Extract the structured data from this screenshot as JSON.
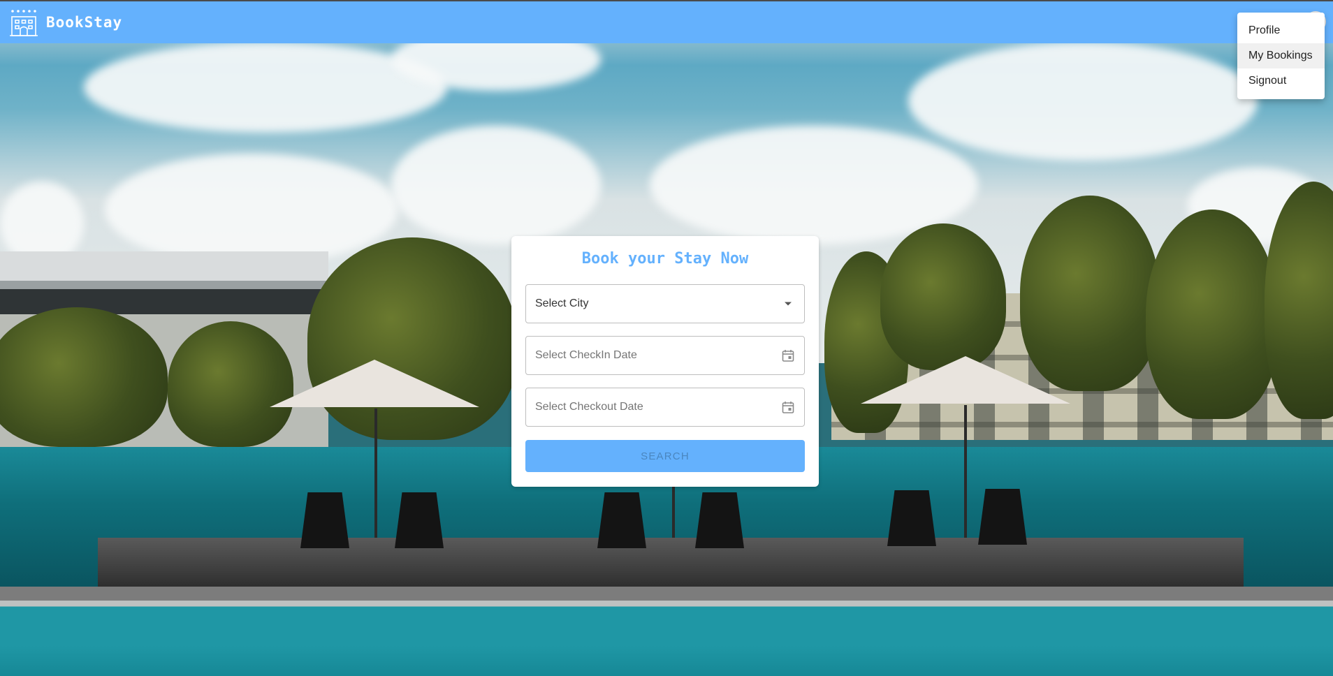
{
  "app": {
    "name": "BookStay"
  },
  "user_menu": {
    "items": [
      {
        "label": "Profile"
      },
      {
        "label": "My Bookings"
      },
      {
        "label": "Signout"
      }
    ],
    "highlighted_item": "My Bookings"
  },
  "booking_form": {
    "title": "Book your Stay Now",
    "city_select": {
      "placeholder": "Select City",
      "icon": "chevron-down-icon"
    },
    "checkin": {
      "placeholder": "Select CheckIn Date",
      "icon": "calendar-icon"
    },
    "checkout": {
      "placeholder": "Select Checkout Date",
      "icon": "calendar-icon"
    },
    "search_label": "SEARCH"
  },
  "colors": {
    "primary": "#64b1fd",
    "card_bg": "#ffffff",
    "menu_bg": "#ffffff",
    "search_text": "#4a86bf"
  }
}
